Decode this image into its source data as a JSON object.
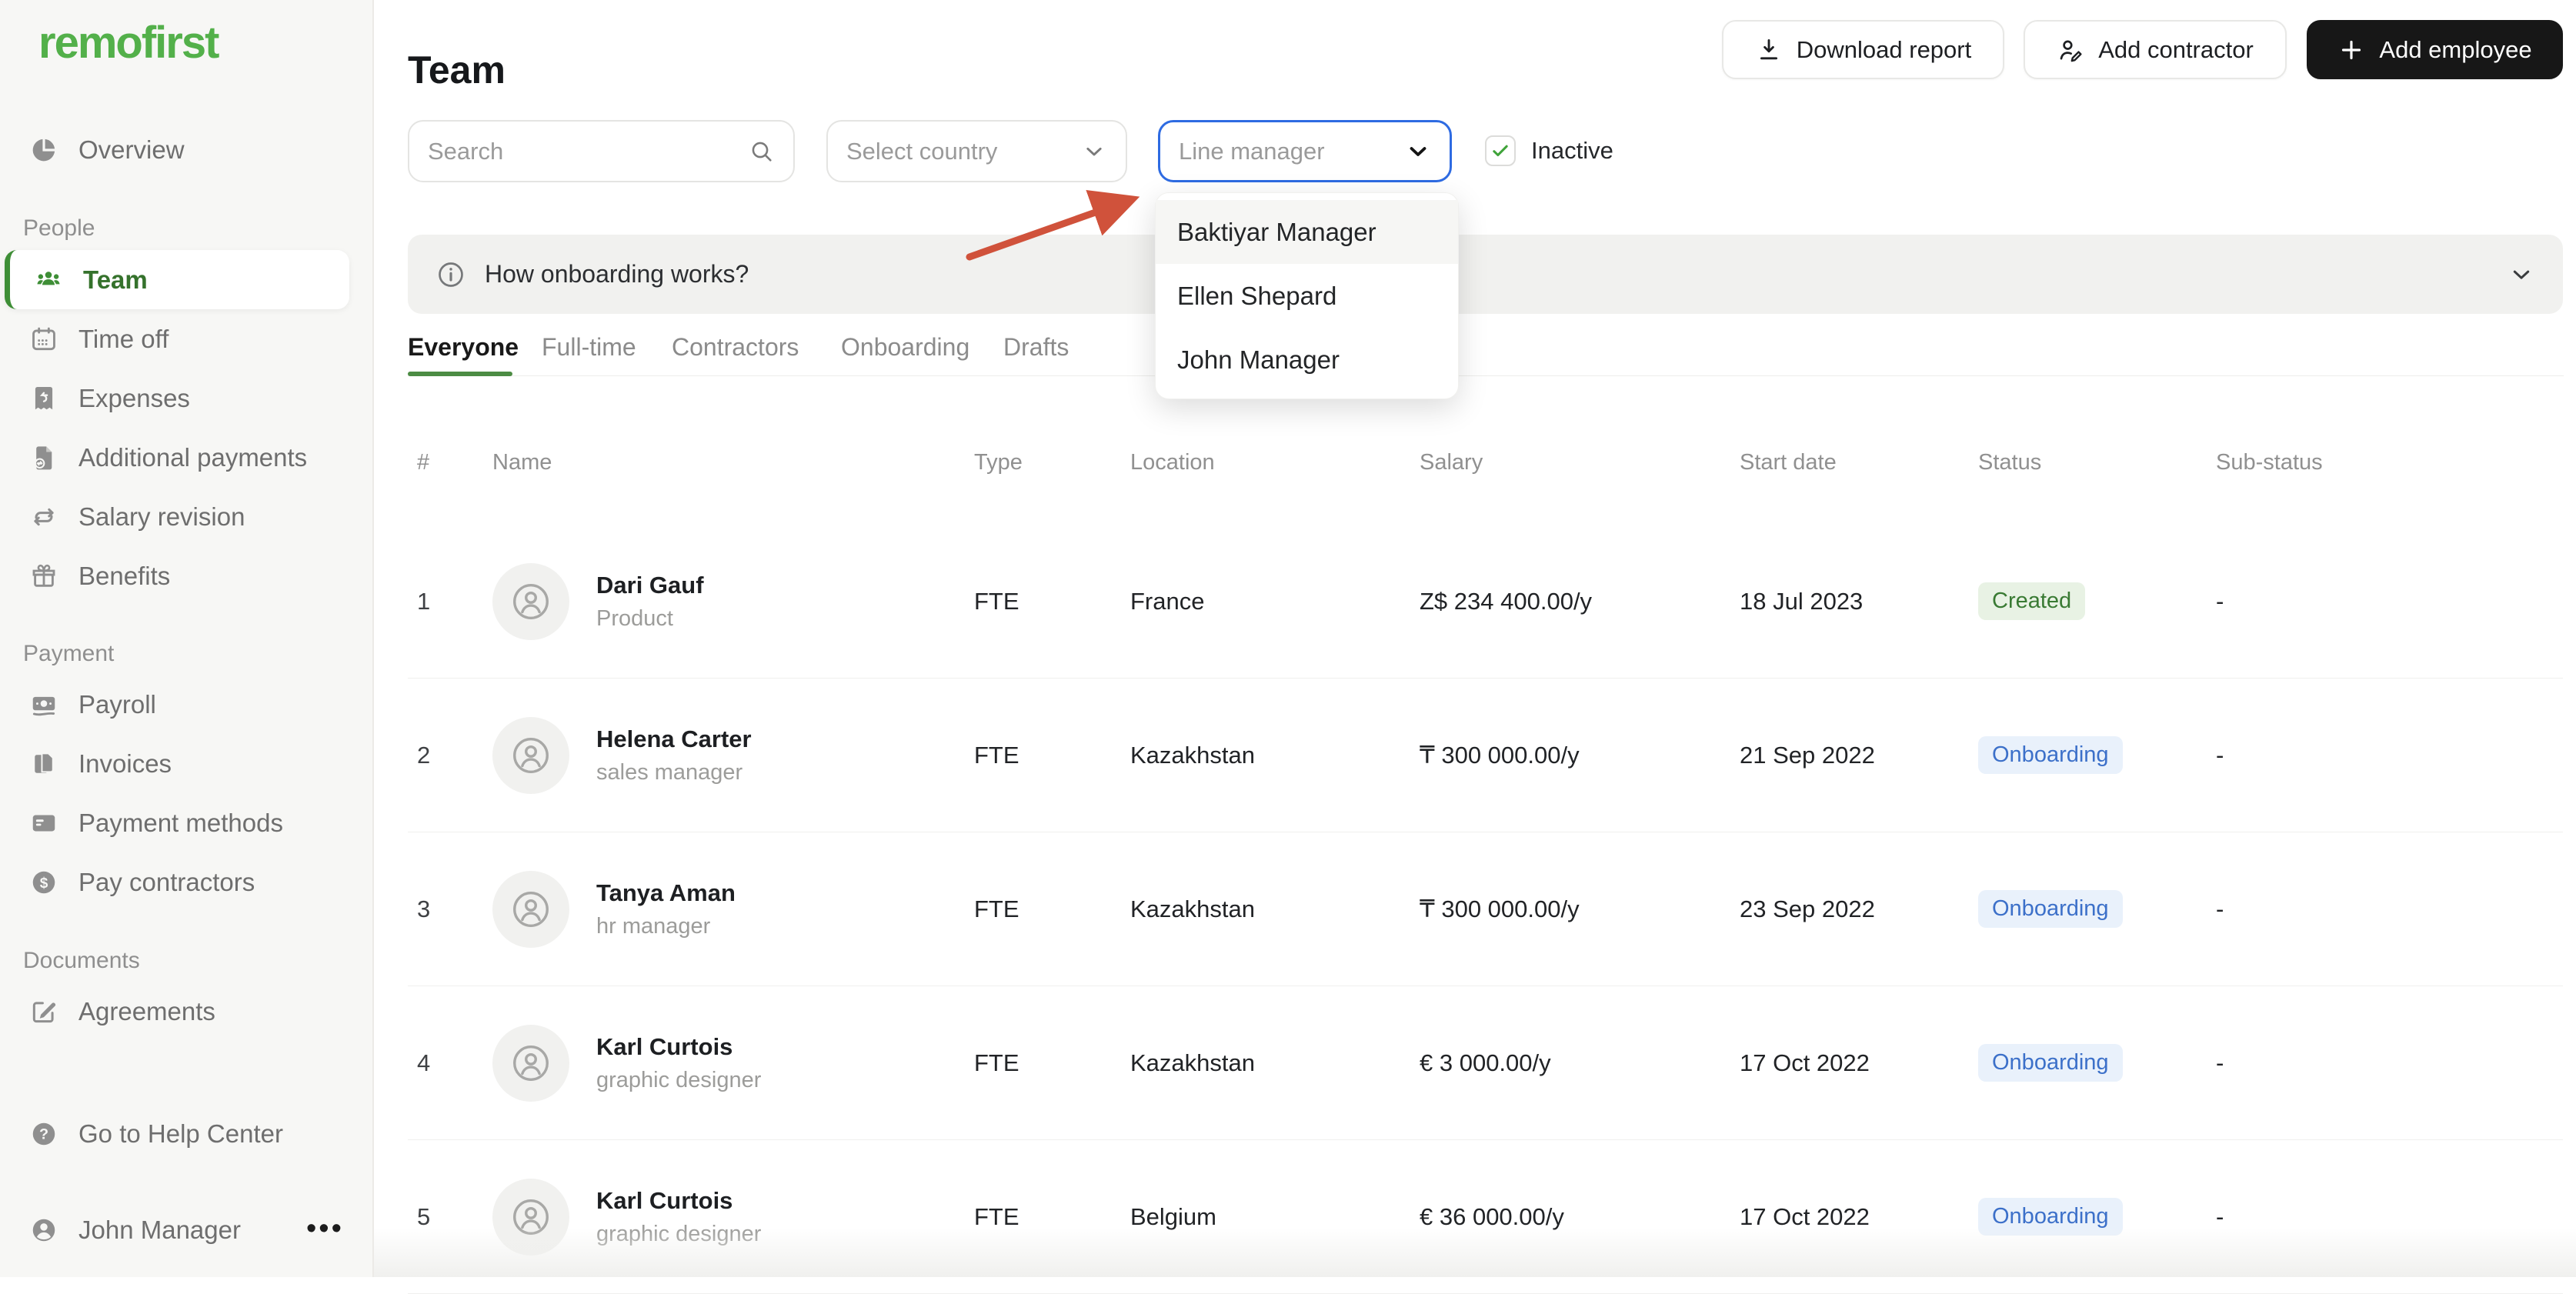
{
  "brand": {
    "logo": "remofirst",
    "green": "#53b04a"
  },
  "sidebar": {
    "sections": [
      {
        "label": "",
        "items": [
          {
            "label": "Overview",
            "icon": "pie-chart-icon",
            "active": false
          }
        ]
      },
      {
        "label": "People",
        "items": [
          {
            "label": "Team",
            "icon": "team-icon",
            "active": true
          },
          {
            "label": "Time off",
            "icon": "calendar-icon",
            "active": false
          },
          {
            "label": "Expenses",
            "icon": "receipt-icon",
            "active": false
          },
          {
            "label": "Additional payments",
            "icon": "document-payment-icon",
            "active": false
          },
          {
            "label": "Salary revision",
            "icon": "cycle-arrows-icon",
            "active": false
          },
          {
            "label": "Benefits",
            "icon": "gift-icon",
            "active": false
          }
        ]
      },
      {
        "label": "Payment",
        "items": [
          {
            "label": "Payroll",
            "icon": "banknote-icon",
            "active": false
          },
          {
            "label": "Invoices",
            "icon": "invoices-icon",
            "active": false
          },
          {
            "label": "Payment methods",
            "icon": "credit-card-icon",
            "active": false
          },
          {
            "label": "Pay contractors",
            "icon": "dollar-circle-icon",
            "active": false
          }
        ]
      },
      {
        "label": "Documents",
        "items": [
          {
            "label": "Agreements",
            "icon": "pencil-square-icon",
            "active": false
          }
        ]
      }
    ],
    "footer": {
      "help_label": "Go to Help Center",
      "user_name": "John Manager",
      "menu_glyph": "•••"
    }
  },
  "header": {
    "title": "Team",
    "buttons": [
      {
        "label": "Download report",
        "icon": "download-icon",
        "style": "light"
      },
      {
        "label": "Add contractor",
        "icon": "person-pen-icon",
        "style": "light"
      },
      {
        "label": "Add employee",
        "icon": "plus-icon",
        "style": "dark"
      }
    ]
  },
  "filters": {
    "search_placeholder": "Search",
    "country_placeholder": "Select country",
    "line_manager_placeholder": "Line manager",
    "inactive_label": "Inactive",
    "inactive_checked": true,
    "focus_color": "#2e6be2",
    "check_color": "#3fa33a"
  },
  "line_manager_dropdown": {
    "options": [
      "Baktiyar Manager",
      "Ellen Shepard",
      "John Manager"
    ],
    "highlighted_index": 0
  },
  "annotation_arrow": {
    "color": "#d0523b",
    "points_at": "line-manager-select"
  },
  "banner": {
    "text": "How onboarding works?"
  },
  "tabs": [
    {
      "label": "Everyone",
      "active": true
    },
    {
      "label": "Full-time",
      "active": false
    },
    {
      "label": "Contractors",
      "active": false
    },
    {
      "label": "Onboarding",
      "active": false
    },
    {
      "label": "Drafts",
      "active": false
    }
  ],
  "table": {
    "columns": [
      "#",
      "Name",
      "Type",
      "Location",
      "Salary",
      "Start date",
      "Status",
      "Sub-status"
    ],
    "rows": [
      {
        "num": "1",
        "name": "Dari Gauf",
        "role": "Product",
        "type": "FTE",
        "location": "France",
        "salary": "Z$ 234 400.00/y",
        "start_date": "18 Jul 2023",
        "status": "Created",
        "status_kind": "created",
        "sub_status": "-"
      },
      {
        "num": "2",
        "name": "Helena Carter",
        "role": "sales manager",
        "type": "FTE",
        "location": "Kazakhstan",
        "salary": "₸ 300 000.00/y",
        "start_date": "21 Sep 2022",
        "status": "Onboarding",
        "status_kind": "onboarding",
        "sub_status": "-"
      },
      {
        "num": "3",
        "name": "Tanya Aman",
        "role": "hr manager",
        "type": "FTE",
        "location": "Kazakhstan",
        "salary": "₸ 300 000.00/y",
        "start_date": "23 Sep 2022",
        "status": "Onboarding",
        "status_kind": "onboarding",
        "sub_status": "-"
      },
      {
        "num": "4",
        "name": "Karl Curtois",
        "role": "graphic designer",
        "type": "FTE",
        "location": "Kazakhstan",
        "salary": "€ 3 000.00/y",
        "start_date": "17 Oct 2022",
        "status": "Onboarding",
        "status_kind": "onboarding",
        "sub_status": "-"
      },
      {
        "num": "5",
        "name": "Karl Curtois",
        "role": "graphic designer",
        "type": "FTE",
        "location": "Belgium",
        "salary": "€ 36 000.00/y",
        "start_date": "17 Oct 2022",
        "status": "Onboarding",
        "status_kind": "onboarding",
        "sub_status": "-"
      }
    ],
    "status_colors": {
      "created": {
        "text": "#397a33",
        "bg": "#e8f2e4"
      },
      "onboarding": {
        "text": "#3c70c9",
        "bg": "#e9f1fb"
      }
    }
  }
}
